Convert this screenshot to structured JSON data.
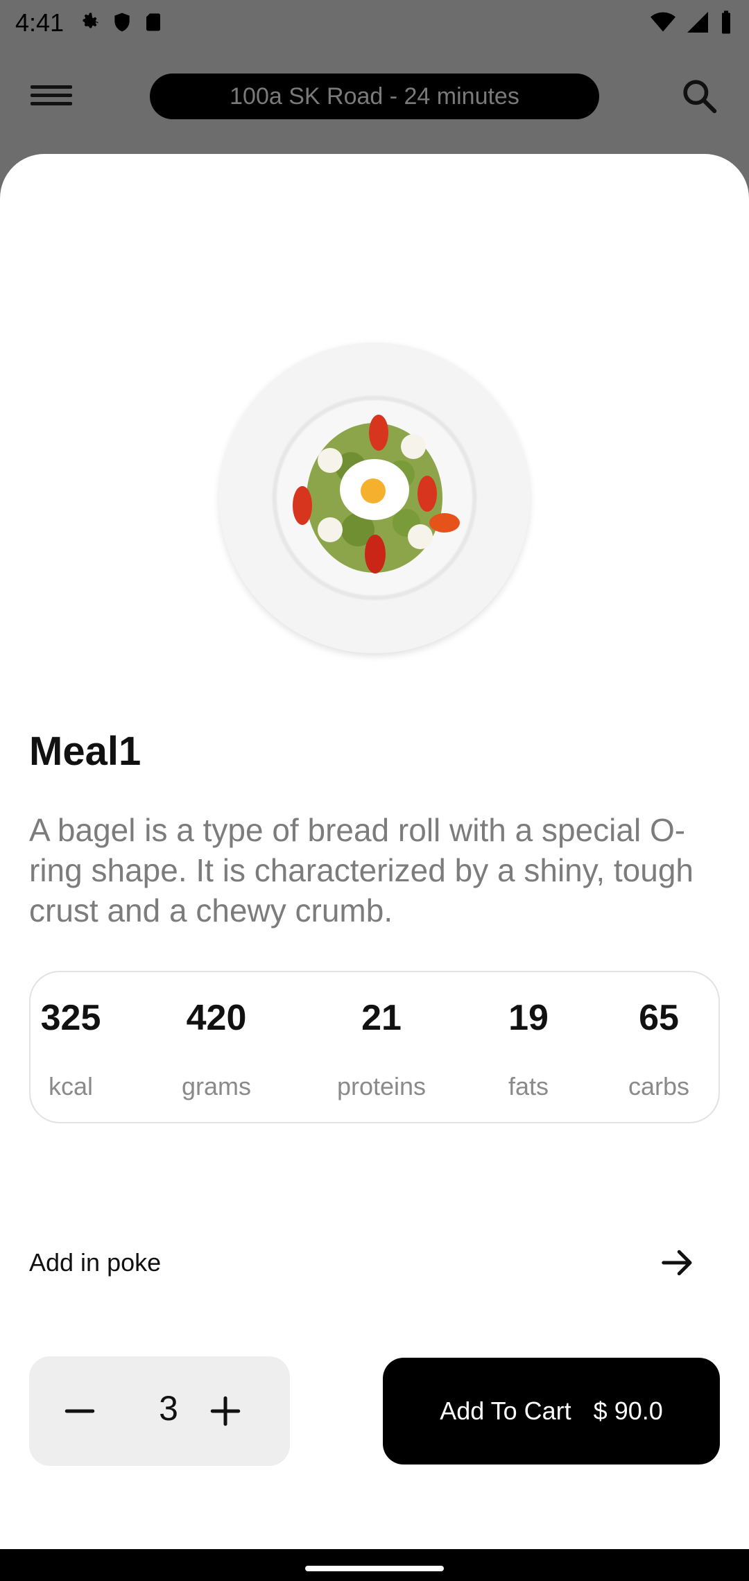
{
  "status_bar": {
    "time": "4:41",
    "left_icons": [
      "settings-icon",
      "shield-icon",
      "sd-card-icon"
    ],
    "right_icons": [
      "wifi-icon",
      "signal-icon",
      "battery-icon"
    ]
  },
  "header": {
    "address": "100a SK Road - 24 minutes",
    "menu_icon": "hamburger-menu-icon",
    "search_icon": "search-icon"
  },
  "meal": {
    "title": "Meal1",
    "description": "A bagel is a type of bread roll with a special O-ring shape. It is characterized by a shiny, tough crust and a chewy crumb.",
    "nutrition": [
      {
        "value": "325",
        "label": "kcal"
      },
      {
        "value": "420",
        "label": "grams"
      },
      {
        "value": "21",
        "label": "proteins"
      },
      {
        "value": "19",
        "label": "fats"
      },
      {
        "value": "65",
        "label": "carbs"
      }
    ]
  },
  "add_in": {
    "label": "Add in poke",
    "icon": "arrow-right-icon"
  },
  "quantity": {
    "value": "3",
    "minus_icon": "minus-icon",
    "plus_icon": "plus-icon"
  },
  "cart": {
    "label": "Add To Cart",
    "price": "$ 90.0"
  },
  "colors": {
    "sheet_bg": "#ffffff",
    "overlay": "#6d6d6d",
    "button_bg": "#000000",
    "muted_text": "#7c7c7c"
  }
}
